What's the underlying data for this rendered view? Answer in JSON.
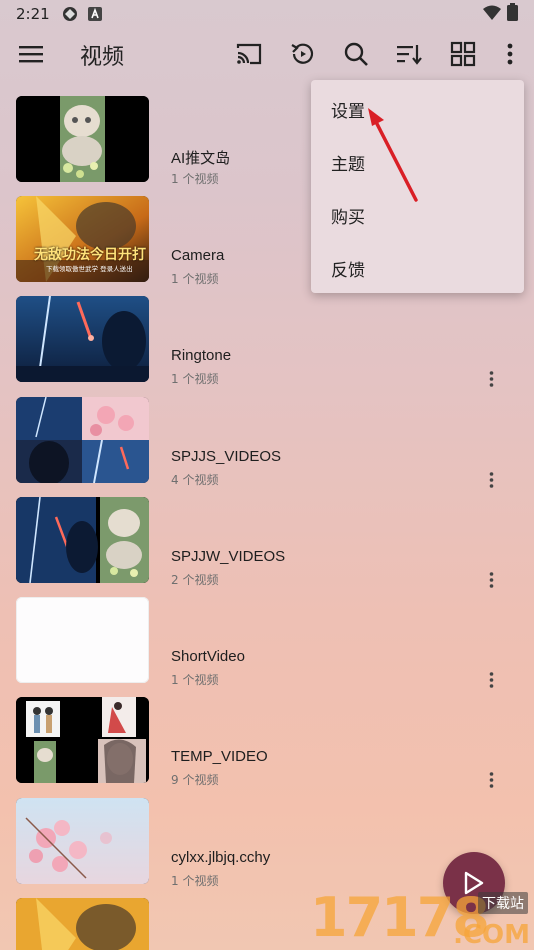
{
  "status_bar": {
    "time": "2:21"
  },
  "app_bar": {
    "title": "视频"
  },
  "toolbar_icons": [
    "cast-icon",
    "history-icon",
    "search-icon",
    "sort-icon",
    "grid-view-icon",
    "more-vert-icon"
  ],
  "folders": [
    {
      "name": "AI推文岛",
      "count": "1 个视频"
    },
    {
      "name": "Camera",
      "count": "1 个视频"
    },
    {
      "name": "Ringtone",
      "count": "1 个视频"
    },
    {
      "name": "SPJJS_VIDEOS",
      "count": "4 个视频"
    },
    {
      "name": "SPJJW_VIDEOS",
      "count": "2 个视频"
    },
    {
      "name": "ShortVideo",
      "count": "1 个视频"
    },
    {
      "name": "TEMP_VIDEO",
      "count": "9 个视频"
    },
    {
      "name": "cylxx.jlbjq.cchy",
      "count": "1 个视频"
    }
  ],
  "thumb_text": {
    "banner_line1": "无敌功法今日开打",
    "banner_line2": "下载领取傲世武学 登录人送出"
  },
  "popup_menu": {
    "items": [
      "设置",
      "主题",
      "购买",
      "反馈"
    ]
  },
  "watermark": {
    "digits": "17178",
    "site": "下载站",
    "suffix": ".COM"
  },
  "colors": {
    "fab": "#7a3148",
    "arrow": "#d91f26",
    "popup_bg": "#eadbdf"
  }
}
